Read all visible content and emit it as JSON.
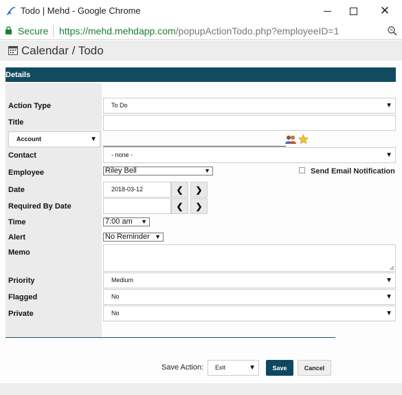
{
  "window": {
    "title": "Todo | Mehd - Google Chrome",
    "minimize_icon": "minimize-icon",
    "maximize_icon": "maximize-icon",
    "close_glyph": "✕"
  },
  "address": {
    "secure_label": "Secure",
    "url_base": "https://mehd.mehdapp.com",
    "url_path": "/popupActionTodo.php?employeeID=1"
  },
  "page": {
    "title": "Calendar / Todo"
  },
  "section": {
    "label": "Details"
  },
  "form": {
    "action_type": {
      "label": "Action Type",
      "value": "To Do"
    },
    "title": {
      "label": "Title",
      "value": ""
    },
    "related": {
      "value": "Account"
    },
    "contact": {
      "label": "Contact",
      "value": "- none -"
    },
    "employee": {
      "label": "Employee",
      "value": "Riley Bell"
    },
    "email_notify": {
      "label": "Send Email Notification",
      "checked": false
    },
    "date": {
      "label": "Date",
      "value": "2018-03-12"
    },
    "required_by": {
      "label": "Required By Date",
      "value": ""
    },
    "time": {
      "label": "Time",
      "value": "7:00 am"
    },
    "alert": {
      "label": "Alert",
      "value": "No Reminder"
    },
    "memo": {
      "label": "Memo",
      "value": ""
    },
    "priority": {
      "label": "Priority",
      "value": "Medium"
    },
    "flagged": {
      "label": "Flagged",
      "value": "No"
    },
    "private": {
      "label": "Private",
      "value": "No"
    }
  },
  "footer": {
    "save_action_label": "Save Action:",
    "save_action_value": "Exit",
    "save_button": "Save",
    "cancel_button": "Cancel"
  },
  "glyphs": {
    "prev": "❮",
    "next": "❯",
    "dropdown": "▼"
  },
  "colors": {
    "accent": "#124a60",
    "secure_green": "#188038"
  }
}
